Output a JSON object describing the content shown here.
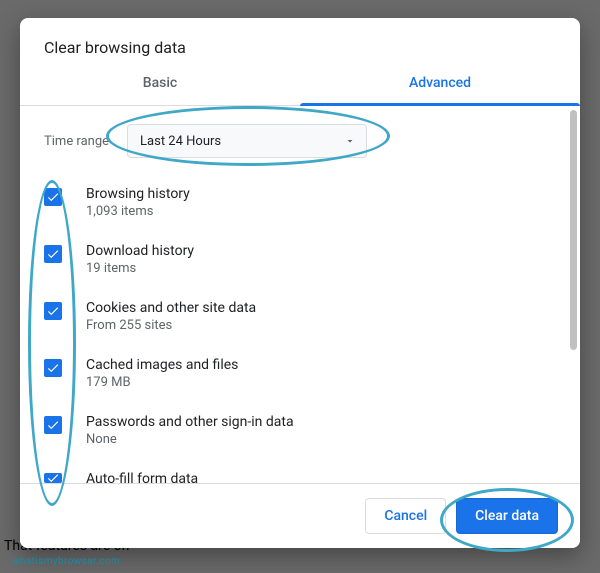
{
  "backdrop": {
    "bottom_text": "That features are on"
  },
  "dialog": {
    "title": "Clear browsing data",
    "tabs": {
      "basic": "Basic",
      "advanced": "Advanced"
    },
    "time_range": {
      "label": "Time range",
      "selected": "Last 24 Hours"
    },
    "items": [
      {
        "title": "Browsing history",
        "sub": "1,093 items",
        "checked": true
      },
      {
        "title": "Download history",
        "sub": "19 items",
        "checked": true
      },
      {
        "title": "Cookies and other site data",
        "sub": "From 255 sites",
        "checked": true
      },
      {
        "title": "Cached images and files",
        "sub": "179 MB",
        "checked": true
      },
      {
        "title": "Passwords and other sign-in data",
        "sub": "None",
        "checked": true
      },
      {
        "title": "Auto-fill form data",
        "sub": "",
        "checked": true
      }
    ],
    "buttons": {
      "cancel": "Cancel",
      "confirm": "Clear data"
    }
  },
  "watermark": "whatismybrowser.com"
}
